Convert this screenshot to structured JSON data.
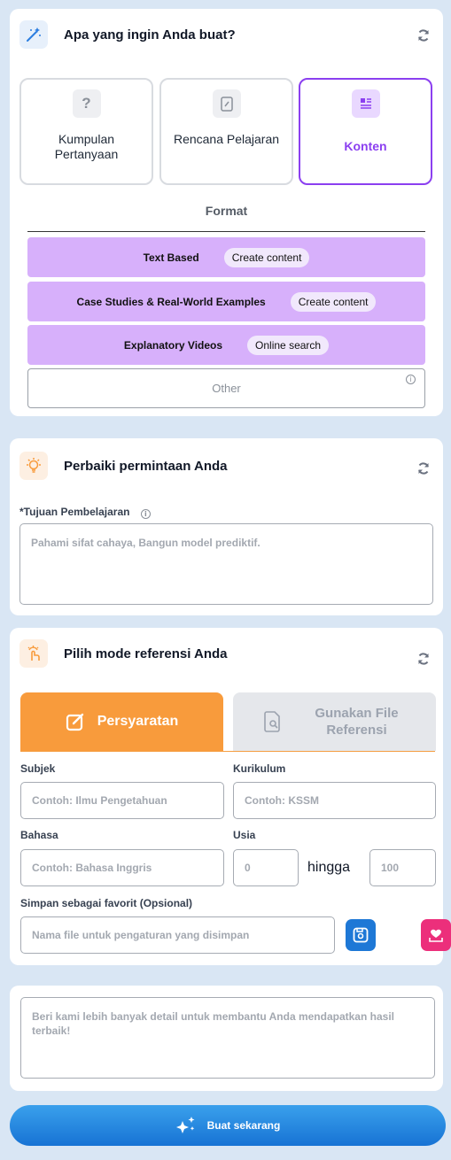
{
  "create": {
    "title": "Apa yang ingin Anda buat?",
    "types": [
      {
        "label": "Kumpulan Pertanyaan",
        "icon": "question-icon"
      },
      {
        "label": "Rencana Pelajaran",
        "icon": "edit-document-icon"
      },
      {
        "label": "Konten",
        "icon": "article-icon",
        "active": true
      }
    ],
    "format_label": "Format",
    "formats": [
      {
        "name": "Text Based",
        "action": "Create content"
      },
      {
        "name": "Case Studies & Real-World Examples",
        "action": "Create content"
      },
      {
        "name": "Explanatory Videos",
        "action": "Online search"
      }
    ],
    "other_label": "Other"
  },
  "refine": {
    "title": "Perbaiki permintaan Anda",
    "objective_label": "*Tujuan Pembelajaran",
    "objective_placeholder": "Pahami sifat cahaya, Bangun model prediktif."
  },
  "reference": {
    "title": "Pilih mode referensi Anda",
    "tab_requirements": "Persyaratan",
    "tab_file": "Gunakan File Referensi",
    "subject_label": "Subjek",
    "subject_placeholder": "Contoh: Ilmu Pengetahuan",
    "curriculum_label": "Kurikulum",
    "curriculum_placeholder": "Contoh: KSSM",
    "language_label": "Bahasa",
    "language_placeholder": "Contoh: Bahasa Inggris",
    "age_label": "Usia",
    "age_min": "0",
    "age_to": "hingga",
    "age_max": "100",
    "favorite_label": "Simpan sebagai favorit (Opsional)",
    "favorite_placeholder": "Nama file untuk pengaturan yang disimpan"
  },
  "details": {
    "placeholder": "Beri kami lebih banyak detail untuk membantu Anda mendapatkan hasil terbaik!"
  },
  "submit_label": "Buat sekarang",
  "colors": {
    "accent_purple": "#8b3ff0",
    "format_row": "#d7b0fb",
    "orange": "#f89b3c",
    "blue": "#1e78d6",
    "pink": "#ec2f7b"
  }
}
